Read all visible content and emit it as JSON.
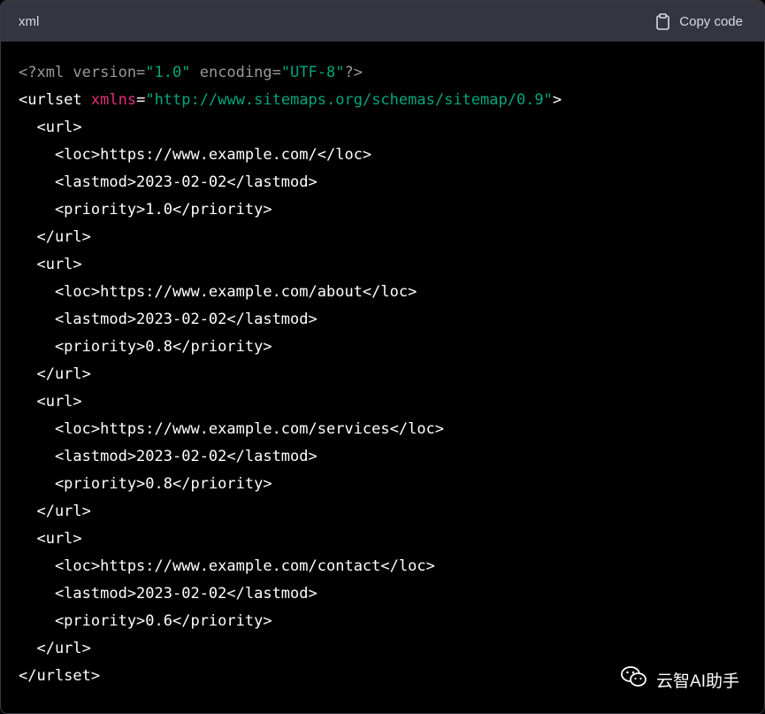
{
  "header": {
    "language": "xml",
    "copy_label": "Copy code"
  },
  "code_lines": [
    [
      {
        "t": "<?xml version=",
        "c": "decl"
      },
      {
        "t": "\"1.0\"",
        "c": "str"
      },
      {
        "t": " encoding=",
        "c": "decl"
      },
      {
        "t": "\"UTF-8\"",
        "c": "str"
      },
      {
        "t": "?>",
        "c": "decl"
      }
    ],
    [
      {
        "t": "<urlset ",
        "c": "tag"
      },
      {
        "t": "xmlns",
        "c": "attr"
      },
      {
        "t": "=",
        "c": "tag"
      },
      {
        "t": "\"http://www.sitemaps.org/schemas/sitemap/0.9\"",
        "c": "str"
      },
      {
        "t": ">",
        "c": "tag"
      }
    ],
    [
      {
        "t": "  <url>",
        "c": "tag"
      }
    ],
    [
      {
        "t": "    <loc>https://www.example.com/</loc>",
        "c": "tag"
      }
    ],
    [
      {
        "t": "    <lastmod>2023-02-02</lastmod>",
        "c": "tag"
      }
    ],
    [
      {
        "t": "    <priority>1.0</priority>",
        "c": "tag"
      }
    ],
    [
      {
        "t": "  </url>",
        "c": "tag"
      }
    ],
    [
      {
        "t": "  <url>",
        "c": "tag"
      }
    ],
    [
      {
        "t": "    <loc>https://www.example.com/about</loc>",
        "c": "tag"
      }
    ],
    [
      {
        "t": "    <lastmod>2023-02-02</lastmod>",
        "c": "tag"
      }
    ],
    [
      {
        "t": "    <priority>0.8</priority>",
        "c": "tag"
      }
    ],
    [
      {
        "t": "  </url>",
        "c": "tag"
      }
    ],
    [
      {
        "t": "  <url>",
        "c": "tag"
      }
    ],
    [
      {
        "t": "    <loc>https://www.example.com/services</loc>",
        "c": "tag"
      }
    ],
    [
      {
        "t": "    <lastmod>2023-02-02</lastmod>",
        "c": "tag"
      }
    ],
    [
      {
        "t": "    <priority>0.8</priority>",
        "c": "tag"
      }
    ],
    [
      {
        "t": "  </url>",
        "c": "tag"
      }
    ],
    [
      {
        "t": "  <url>",
        "c": "tag"
      }
    ],
    [
      {
        "t": "    <loc>https://www.example.com/contact</loc>",
        "c": "tag"
      }
    ],
    [
      {
        "t": "    <lastmod>2023-02-02</lastmod>",
        "c": "tag"
      }
    ],
    [
      {
        "t": "    <priority>0.6</priority>",
        "c": "tag"
      }
    ],
    [
      {
        "t": "  </url>",
        "c": "tag"
      }
    ],
    [
      {
        "t": "</urlset>",
        "c": "tag"
      }
    ]
  ],
  "watermark": {
    "text": "云智AI助手",
    "icon": "wechat-icon"
  },
  "colors": {
    "header_bg": "#343541",
    "code_bg": "#000000",
    "string": "#00a67d",
    "attribute": "#e2307d",
    "declaration": "#9a9a9a"
  }
}
